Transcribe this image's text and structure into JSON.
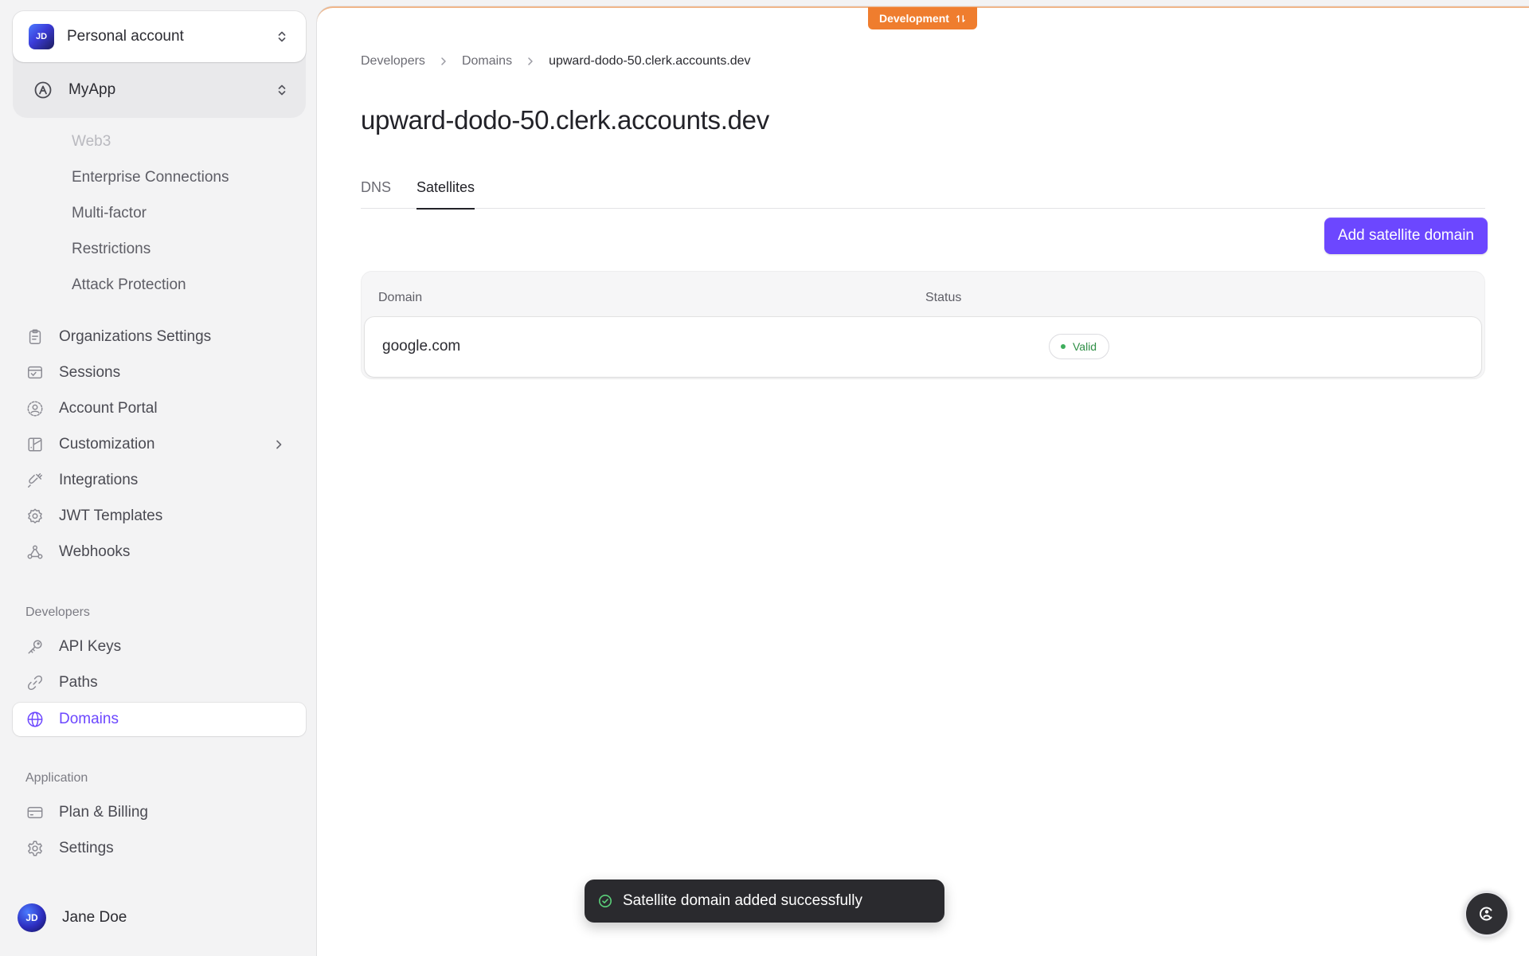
{
  "sidebar": {
    "account": {
      "label": "Personal account",
      "initials": "JD"
    },
    "app": {
      "label": "MyApp"
    },
    "subitems": [
      "Web3",
      "Enterprise Connections",
      "Multi-factor",
      "Restrictions",
      "Attack Protection"
    ],
    "config_items": [
      {
        "label": "Organizations Settings",
        "icon": "clipboard-icon"
      },
      {
        "label": "Sessions",
        "icon": "sessions-icon"
      },
      {
        "label": "Account Portal",
        "icon": "account-portal-icon"
      },
      {
        "label": "Customization",
        "icon": "customization-icon",
        "has_chevron": true
      },
      {
        "label": "Integrations",
        "icon": "plug-icon"
      },
      {
        "label": "JWT Templates",
        "icon": "badge-icon"
      },
      {
        "label": "Webhooks",
        "icon": "webhook-icon"
      }
    ],
    "developers_section": "Developers",
    "developer_items": [
      {
        "label": "API Keys",
        "icon": "key-icon"
      },
      {
        "label": "Paths",
        "icon": "link-icon"
      },
      {
        "label": "Domains",
        "icon": "globe-icon",
        "active": true
      }
    ],
    "application_section": "Application",
    "application_items": [
      {
        "label": "Plan & Billing",
        "icon": "credit-card-icon"
      },
      {
        "label": "Settings",
        "icon": "gear-icon"
      }
    ],
    "user": {
      "name": "Jane Doe",
      "initials": "JD"
    }
  },
  "env_badge": "Development",
  "breadcrumb": [
    "Developers",
    "Domains",
    "upward-dodo-50.clerk.accounts.dev"
  ],
  "page_title": "upward-dodo-50.clerk.accounts.dev",
  "tabs": [
    {
      "label": "DNS",
      "active": false
    },
    {
      "label": "Satellites",
      "active": true
    }
  ],
  "add_button": "Add satellite domain",
  "table": {
    "columns": [
      "Domain",
      "Status"
    ],
    "rows": [
      {
        "domain": "google.com",
        "status": "Valid"
      }
    ]
  },
  "toast": "Satellite domain added successfully",
  "colors": {
    "accent": "#6c47ff",
    "env_badge": "#ef7d2e",
    "status_valid": "#2f8f46",
    "toast_bg": "#2a2a2e"
  }
}
